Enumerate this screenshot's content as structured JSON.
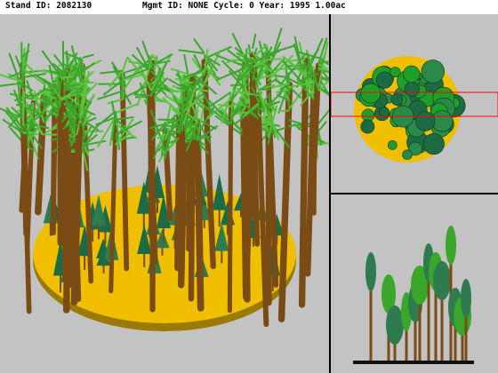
{
  "header": {
    "stand_id": "Stand ID: 2082130",
    "mgmt_line": "Mgmt ID: NONE Cycle: 0 Year: 1995 1.00ac"
  },
  "views": {
    "perspective": "perspective-view",
    "plan": "plan-view",
    "profile": "profile-view"
  },
  "colors": {
    "background": "#c3c3c3",
    "ground": "#f0c000",
    "trunk": "#7a4b14",
    "foliage": "#3aa62a",
    "foliage_dark": "#1d6b45",
    "crown_plan": "#1f9e2b",
    "selection": "#ff0000"
  }
}
